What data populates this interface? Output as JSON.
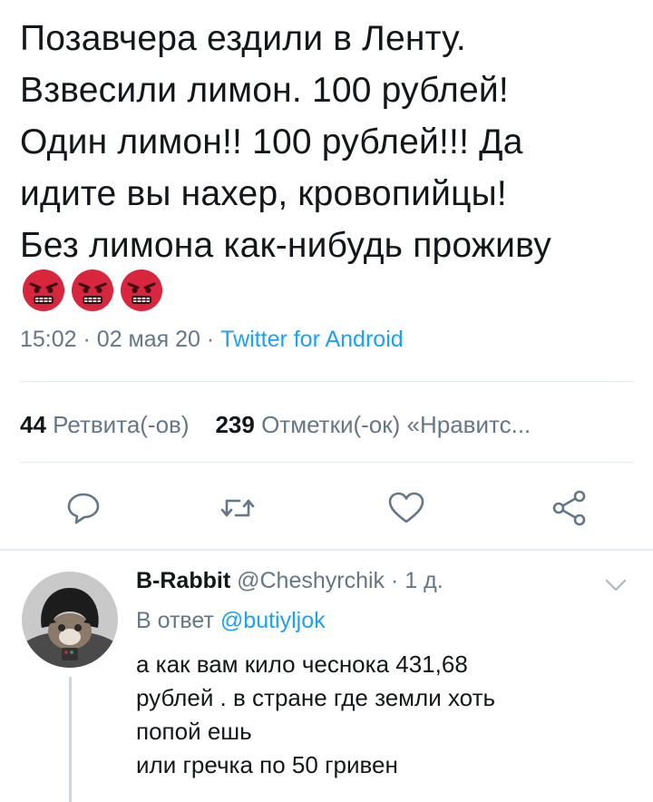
{
  "tweet": {
    "text_lines": [
      "Позавчера ездили в Ленту.",
      "Взвесили лимон. 100 рублей!",
      "Один лимон!! 100 рублей!!! Да",
      "идите вы нахер, кровопийцы!",
      "Без лимона как-нибудь проживу"
    ],
    "emoji_icon": "angry-face-icon",
    "time": "15:02",
    "separator": "·",
    "date": "02 мая 20",
    "source": "Twitter for Android"
  },
  "stats": {
    "retweets_count": "44",
    "retweets_label": "Ретвита(-ов)",
    "likes_count": "239",
    "likes_label": "Отметки(-ок) «Нравитс..."
  },
  "reply": {
    "name": "B-Rabbit",
    "handle": "@Cheshyrchik",
    "separator": "·",
    "age": "1 д.",
    "reply_to_label": "В ответ",
    "reply_to_handle": "@butiyljok",
    "text_lines": [
      "а как вам кило чеснока 431,68",
      "рублей . в стране где земли хоть",
      "попой ешь",
      "или гречка по 50 гривен"
    ]
  },
  "colors": {
    "link_blue": "#1da1f2",
    "secondary_gray": "#657786",
    "emoji_red": "#d7263d"
  }
}
